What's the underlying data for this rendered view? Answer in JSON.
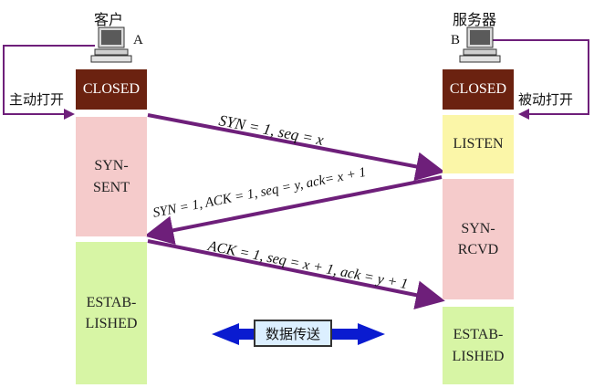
{
  "client": {
    "title": "客户",
    "letter": "A",
    "open_label": "主动打开",
    "states": [
      "CLOSED",
      "SYN-\nSENT",
      "ESTAB-\nLISHED"
    ]
  },
  "server": {
    "title": "服务器",
    "letter": "B",
    "open_label": "被动打开",
    "states": [
      "CLOSED",
      "LISTEN",
      "SYN-\nRCVD",
      "ESTAB-\nLISHED"
    ]
  },
  "messages": [
    "SYN = 1, seq = x",
    "SYN = 1, ACK = 1, seq = y, ack= x + 1",
    "ACK = 1, seq = x + 1, ack = y + 1"
  ],
  "transfer": "数据传送",
  "colors": {
    "arrow": "#6e1f7a",
    "closed": "#6b2210",
    "transfer_arrow": "#0a1bd0"
  }
}
